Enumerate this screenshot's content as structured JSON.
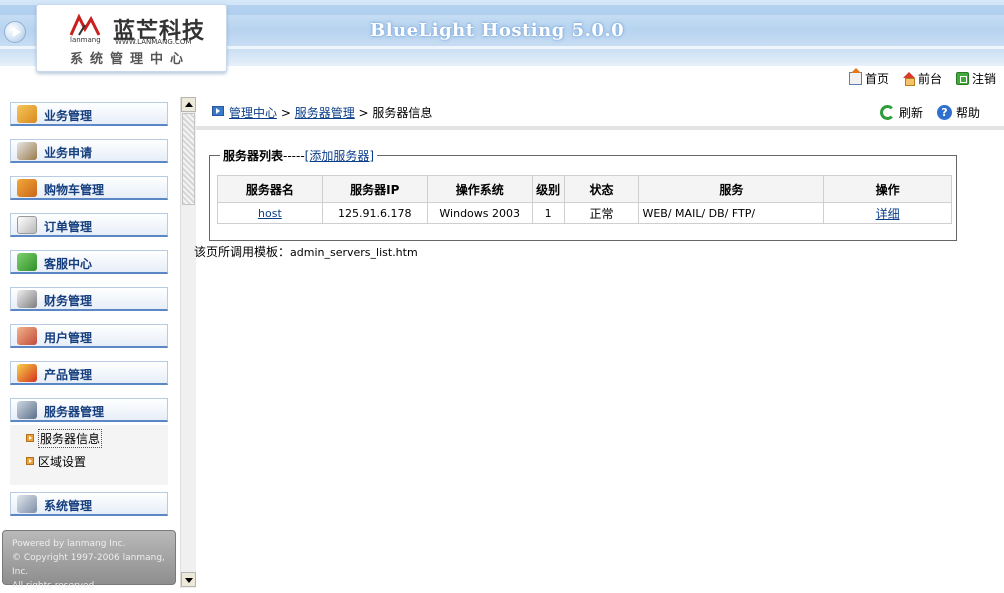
{
  "header": {
    "app_title": "BlueLight Hosting 5.0.0",
    "logo": {
      "cn": "蓝芒科技",
      "en": "lanmang",
      "url": "WWW.LANMANG.COM",
      "subtitle": "系统管理中心"
    },
    "links": [
      {
        "label": "首页",
        "icon": "home-icon"
      },
      {
        "label": "前台",
        "icon": "front-house-icon"
      },
      {
        "label": "注销",
        "icon": "logout-icon"
      }
    ]
  },
  "sidebar": {
    "items": [
      {
        "label": "业务管理",
        "icon": "business-box-icon"
      },
      {
        "label": "业务申请",
        "icon": "pen-apply-icon"
      },
      {
        "label": "购物车管理",
        "icon": "shopping-cart-icon"
      },
      {
        "label": "订单管理",
        "icon": "order-document-icon"
      },
      {
        "label": "客服中心",
        "icon": "checkmark-support-icon"
      },
      {
        "label": "财务管理",
        "icon": "finance-pen-icon"
      },
      {
        "label": "用户管理",
        "icon": "users-icon"
      },
      {
        "label": "产品管理",
        "icon": "product-award-icon"
      },
      {
        "label": "服务器管理",
        "icon": "server-icon"
      },
      {
        "label": "系统管理",
        "icon": "system-tools-icon"
      }
    ],
    "submenu": [
      {
        "label": "服务器信息",
        "active": true
      },
      {
        "label": "区域设置",
        "active": false
      }
    ],
    "footer": {
      "powered": "Powered by lanmang Inc.",
      "copyright": "© Copyright 1997-2006 lanmang, Inc.",
      "rights": "All rights reserved"
    }
  },
  "content": {
    "breadcrumb": {
      "root": "管理中心",
      "sep1": " > ",
      "parent": "服务器管理",
      "sep2": " > ",
      "current": "服务器信息"
    },
    "tools": {
      "refresh": "刷新",
      "help": "帮助"
    },
    "fieldset": {
      "title": "服务器列表",
      "dashes": "-----",
      "add_link": "[添加服务器]"
    },
    "table": {
      "headers": [
        "服务器名",
        "服务器IP",
        "操作系统",
        "级别",
        "状态",
        "服务",
        "操作"
      ],
      "rows": [
        {
          "name": "host",
          "ip": "125.91.6.178",
          "os": "Windows 2003",
          "level": "1",
          "status": "正常",
          "services": "WEB/ MAIL/ DB/ FTP/",
          "action": "详细"
        }
      ]
    },
    "template_note": {
      "label": "该页所调用模板：",
      "file": "admin_servers_list.htm"
    }
  },
  "colors": {
    "menu_label": "#153e7e",
    "link": "#0b3e8a",
    "banner": "#b7d3ef",
    "menu_border": "#5b87c5"
  }
}
